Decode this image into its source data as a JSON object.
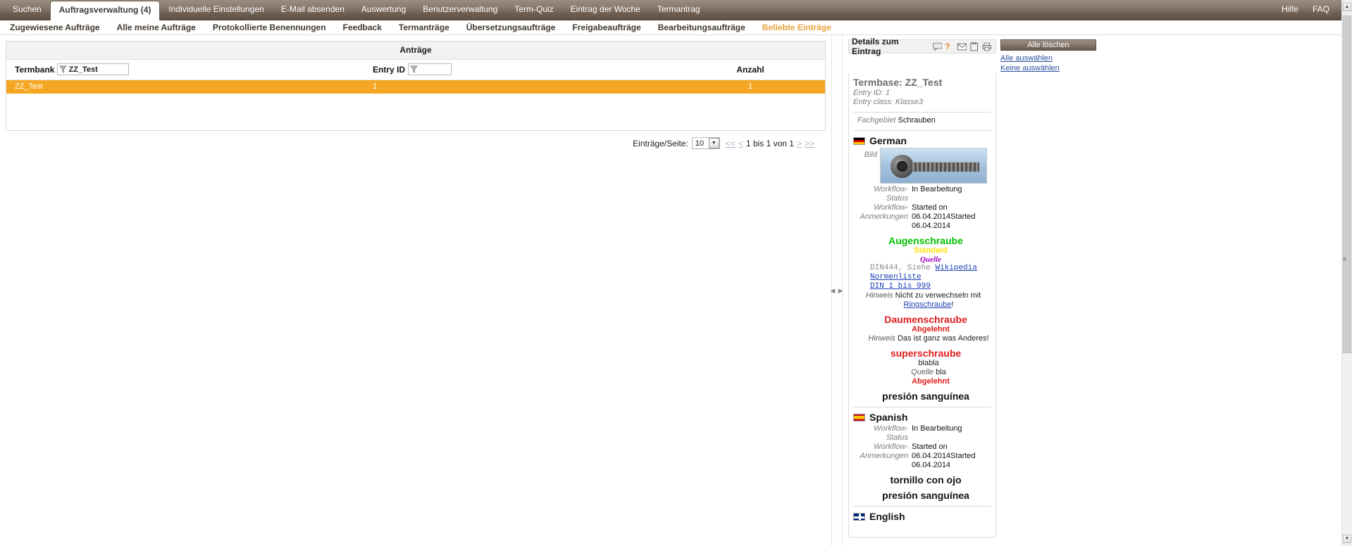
{
  "topnav": {
    "tabs": [
      {
        "label": "Suchen",
        "active": false
      },
      {
        "label": "Auftragsverwaltung (4)",
        "active": true
      },
      {
        "label": "Individuelle Einstellungen",
        "active": false
      },
      {
        "label": "E-Mail absenden",
        "active": false
      },
      {
        "label": "Auswertung",
        "active": false
      },
      {
        "label": "Benutzerverwaltung",
        "active": false
      },
      {
        "label": "Term-Quiz",
        "active": false
      },
      {
        "label": "Eintrag der Woche",
        "active": false
      },
      {
        "label": "Termantrag",
        "active": false
      }
    ],
    "right_links": [
      {
        "label": "Hilfe"
      },
      {
        "label": "FAQ"
      }
    ]
  },
  "subnav": {
    "items": [
      {
        "label": "Zugewiesene Aufträge",
        "selected": false
      },
      {
        "label": "Alle meine Aufträge",
        "selected": false
      },
      {
        "label": "Protokollierte Benennungen",
        "selected": false
      },
      {
        "label": "Feedback",
        "selected": false
      },
      {
        "label": "Termanträge",
        "selected": false
      },
      {
        "label": "Übersetzungsaufträge",
        "selected": false
      },
      {
        "label": "Freigabeaufträge",
        "selected": false
      },
      {
        "label": "Bearbeitungsaufträge",
        "selected": false
      },
      {
        "label": "Beliebte Einträge",
        "selected": true
      }
    ]
  },
  "table": {
    "title": "Anträge",
    "columns": {
      "termbank": "Termbank",
      "entry_id": "Entry ID",
      "anzahl": "Anzahl"
    },
    "filters": {
      "termbank_value": "ZZ_Test",
      "entry_id_value": ""
    },
    "rows": [
      {
        "termbank": "ZZ_Test",
        "entry_id": "1",
        "anzahl": "1",
        "selected": true
      }
    ]
  },
  "pager": {
    "label": "Einträge/Seite:",
    "per_page": "10",
    "first": "<<",
    "prev": "<",
    "range_text": "1 bis 1 von 1",
    "next": ">",
    "last": ">>"
  },
  "details": {
    "header_title": "Details zum Eintrag",
    "icons": [
      "comment-icon",
      "help-icon",
      "mail-icon",
      "clipboard-icon",
      "print-icon"
    ],
    "delete_all_button": "Alle löschen",
    "select_all_link": "Alle auswählen",
    "select_none_link": "Keine auswählen",
    "termbase_title": "Termbase: ZZ_Test",
    "entry_id": "Entry ID: 1",
    "entry_class": "Entry class: Klasse3",
    "fachgebiet": {
      "label": "Fachgebiet",
      "value": "Schrauben"
    },
    "languages": [
      {
        "flag": "de-flag",
        "name": "German",
        "image_label": "Bild",
        "image_alt": "eye-bolt-screw-photo",
        "workflow_status_label": "Workflow-Status",
        "workflow_status_value": "In Bearbeitung",
        "workflow_notes_label": "Workflow-Anmerkungen",
        "workflow_notes_value": "Started on 06.04.2014Started 06.04.2014",
        "terms": [
          {
            "name": "Augenschraube",
            "color": "green",
            "status": "Standard",
            "status_color": "yellow",
            "quelle_label": "Quelle",
            "quelle_text": "DIN444, Siehe",
            "quelle_link1": "Wikipedia Normenliste",
            "quelle_link2": "DIN 1 bis 999",
            "hinweis_label": "Hinweis",
            "hinweis_text": "Nicht zu verwechseln mit",
            "hinweis_link": "Ringschraube",
            "hinweis_tail": "!"
          },
          {
            "name": "Daumenschraube",
            "color": "red",
            "status": "Abgelehnt",
            "status_color": "red",
            "hinweis_label": "Hinweis",
            "hinweis_text": "Das ist ganz was Anderes!"
          },
          {
            "name": "superschraube",
            "color": "red",
            "note_line": "blabla",
            "quelle_label": "Quelle",
            "quelle_text": "bla",
            "status": "Abgelehnt",
            "status_color": "red"
          },
          {
            "name": "presión sanguínea",
            "color": "black"
          }
        ]
      },
      {
        "flag": "es-flag",
        "name": "Spanish",
        "workflow_status_label": "Workflow-Status",
        "workflow_status_value": "In Bearbeitung",
        "workflow_notes_label": "Workflow-Anmerkungen",
        "workflow_notes_value": "Started on 06.04.2014Started 06.04.2014",
        "terms": [
          {
            "name": "tornillo con ojo",
            "color": "black"
          },
          {
            "name": "presión sanguínea",
            "color": "black"
          }
        ]
      },
      {
        "flag": "en-flag",
        "name": "English",
        "terms": []
      }
    ]
  },
  "colors": {
    "nav_dark": "#6d5e52",
    "accent_orange": "#f5a623",
    "selected_link": "#e8a33d"
  }
}
